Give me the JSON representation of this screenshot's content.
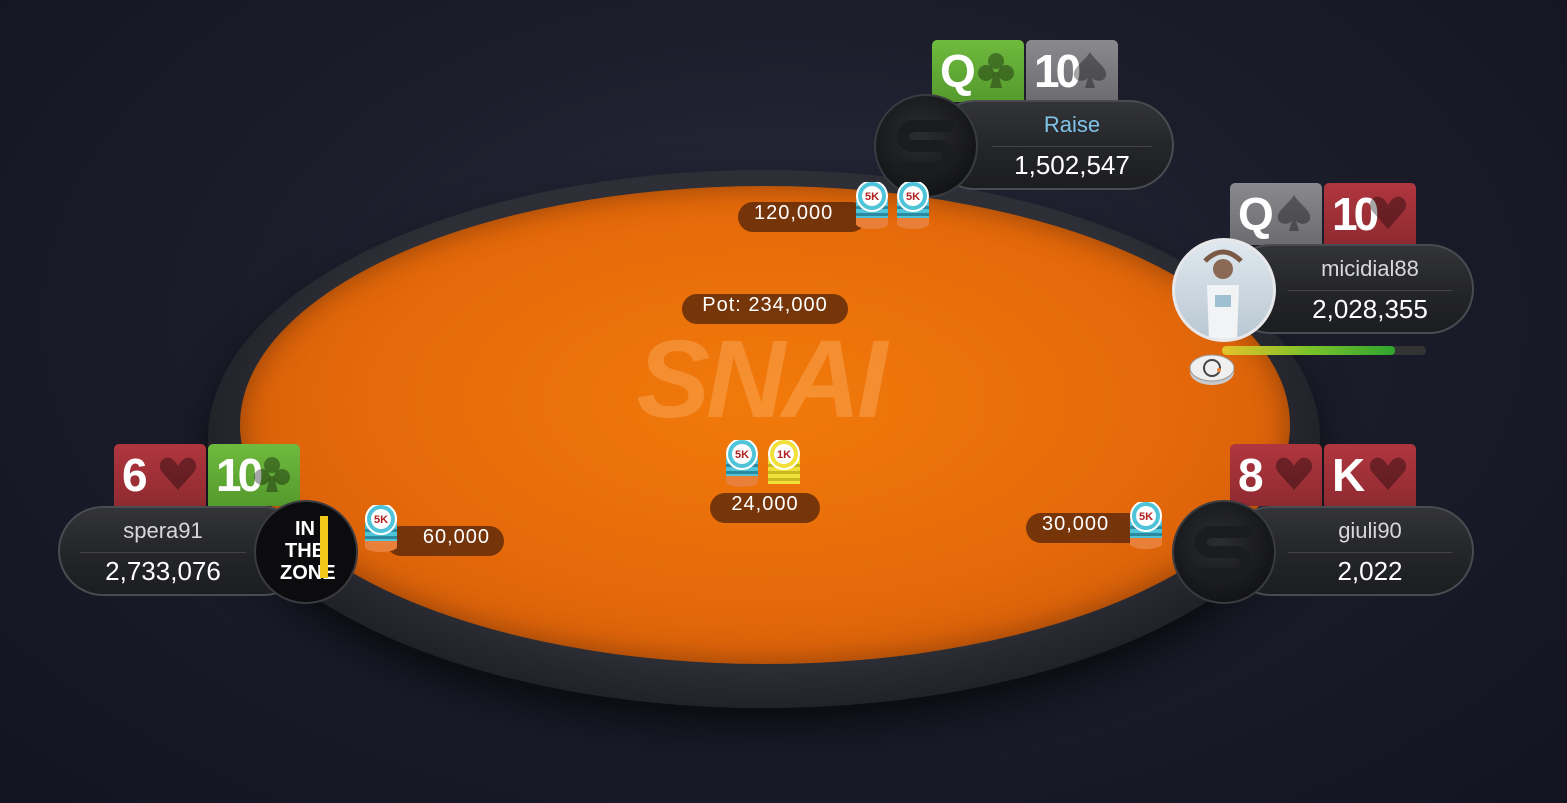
{
  "table": {
    "brand_logo": "SNAI",
    "pot_label": "Pot: 234,000",
    "center_bet": "24,000",
    "felt_color": "#e8690a"
  },
  "players": [
    {
      "id": "top",
      "name": "Raise",
      "name_color": "#7fc4e8",
      "stack": "1,502,547",
      "bet": "120,000",
      "avatar": "snai-logo-avatar",
      "cards": [
        {
          "rank": "Q",
          "suit": "club",
          "color": "green"
        },
        {
          "rank": "10",
          "suit": "spade",
          "color": "gray"
        }
      ]
    },
    {
      "id": "right-top",
      "name": "micidial88",
      "name_color": "#d8d8dc",
      "stack": "2,028,355",
      "bet": "",
      "avatar": "photo-avatar",
      "timer_fraction": 0.85,
      "cards": [
        {
          "rank": "Q",
          "suit": "spade",
          "color": "gray"
        },
        {
          "rank": "10",
          "suit": "heart",
          "color": "red"
        }
      ]
    },
    {
      "id": "right-bottom",
      "name": "giuli90",
      "name_color": "#d8d8dc",
      "stack": "2,022",
      "bet": "30,000",
      "avatar": "snai-logo-avatar",
      "cards": [
        {
          "rank": "8",
          "suit": "heart",
          "color": "red"
        },
        {
          "rank": "K",
          "suit": "heart",
          "color": "red"
        }
      ]
    },
    {
      "id": "left",
      "name": "spera91",
      "name_color": "#d8d8dc",
      "stack": "2,733,076",
      "bet": "60,000",
      "avatar": "in-the-zone-logo-avatar",
      "avatar_text": "IN THE ZONE",
      "cards": [
        {
          "rank": "6",
          "suit": "heart",
          "color": "red"
        },
        {
          "rank": "10",
          "suit": "club",
          "color": "green"
        }
      ]
    }
  ],
  "chips": {
    "5k_label": "5K",
    "1k_label": "1K"
  }
}
